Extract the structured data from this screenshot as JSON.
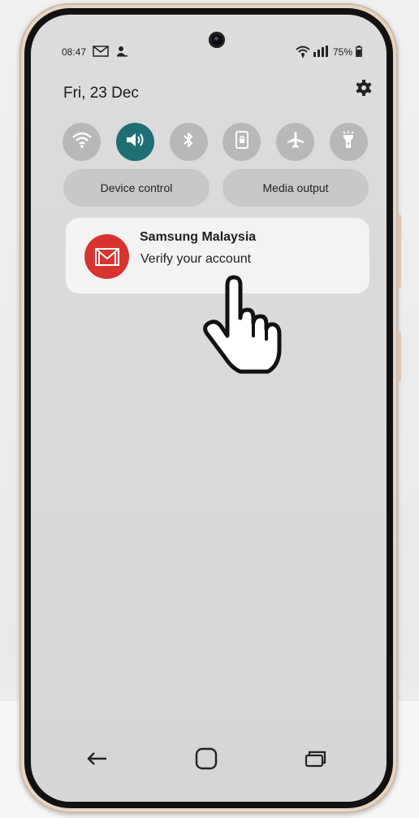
{
  "status_bar": {
    "time": "08:47",
    "battery": "75%"
  },
  "header": {
    "date": "Fri, 23 Dec"
  },
  "quick_settings": [
    {
      "icon": "wifi-icon",
      "active": false
    },
    {
      "icon": "sound-icon",
      "active": true
    },
    {
      "icon": "bluetooth-icon",
      "active": false
    },
    {
      "icon": "portrait-lock-icon",
      "active": false
    },
    {
      "icon": "airplane-icon",
      "active": false
    },
    {
      "icon": "flashlight-icon",
      "active": false
    }
  ],
  "buttons": {
    "device_control": "Device control",
    "media_output": "Media output"
  },
  "notification": {
    "title": "Samsung Malaysia",
    "body": "Verify your account",
    "icon": "gmail-icon",
    "icon_color": "#d8342f"
  },
  "nav_bar": {
    "items": [
      "back-icon",
      "home-icon",
      "recents-icon"
    ]
  },
  "colors": {
    "active_toggle": "#1e6e74",
    "inactive_toggle": "#b8b8b8",
    "notification_icon": "#d8342f"
  }
}
